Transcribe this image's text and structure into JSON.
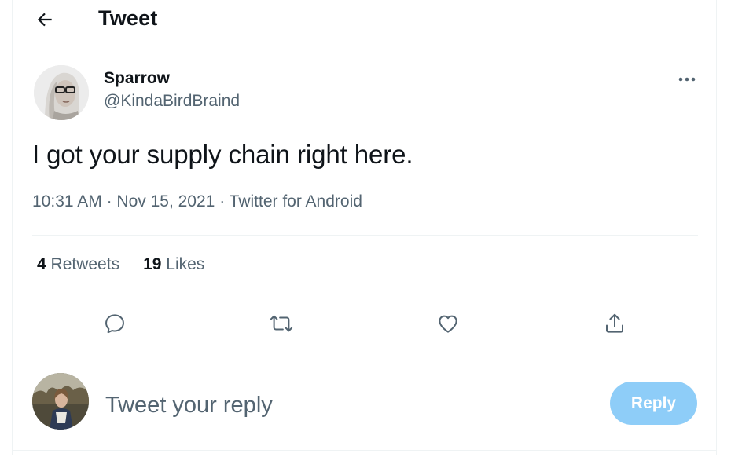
{
  "header": {
    "back_icon": "arrow-left-icon",
    "title": "Tweet"
  },
  "tweet": {
    "author_name": "Sparrow",
    "author_handle": "@KindaBirdBraind",
    "more_icon": "more-horizontal-icon",
    "text": "I got your supply chain right here.",
    "time": "10:31 AM",
    "separator": "·",
    "date": "Nov 15, 2021",
    "source": "Twitter for Android"
  },
  "stats": {
    "retweets_count": "4",
    "retweets_label": "Retweets",
    "likes_count": "19",
    "likes_label": "Likes"
  },
  "actions": [
    {
      "name": "reply",
      "icon": "comment-icon"
    },
    {
      "name": "retweet",
      "icon": "retweet-icon"
    },
    {
      "name": "like",
      "icon": "heart-icon"
    },
    {
      "name": "share",
      "icon": "share-icon"
    }
  ],
  "reply_box": {
    "placeholder": "Tweet your reply",
    "value": "",
    "button_label": "Reply"
  },
  "colors": {
    "text_primary": "#0f1419",
    "text_secondary": "#536471",
    "divider": "#eff3f4",
    "reply_button_disabled": "#8ecdf8",
    "accent": "#1d9bf0"
  }
}
